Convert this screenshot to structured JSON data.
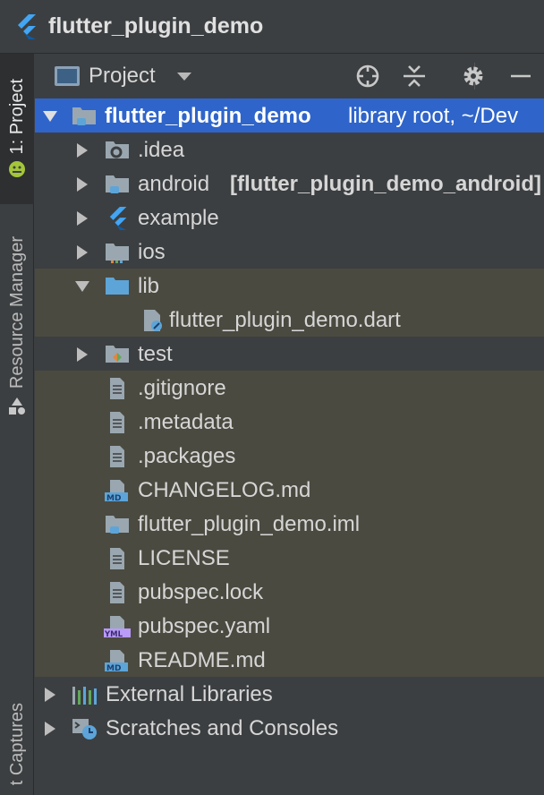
{
  "window": {
    "title": "flutter_plugin_demo"
  },
  "left_strip": {
    "tabs": [
      {
        "label": "1: Project"
      },
      {
        "label": "Resource Manager"
      },
      {
        "label": "t Captures"
      }
    ]
  },
  "toolbar": {
    "view_label": "Project",
    "icons": [
      "locate-icon",
      "collapse-all-icon",
      "gear-icon",
      "minimize-icon"
    ]
  },
  "tree": {
    "root": {
      "name": "flutter_plugin_demo",
      "extra": "library root,  ~/Dev"
    },
    "items": [
      {
        "name": ".idea"
      },
      {
        "name": "android",
        "module": "[flutter_plugin_demo_android]"
      },
      {
        "name": "example"
      },
      {
        "name": "ios"
      },
      {
        "name": "lib"
      },
      {
        "name": "flutter_plugin_demo.dart"
      },
      {
        "name": "test"
      },
      {
        "name": ".gitignore"
      },
      {
        "name": ".metadata"
      },
      {
        "name": ".packages"
      },
      {
        "name": "CHANGELOG.md"
      },
      {
        "name": "flutter_plugin_demo.iml"
      },
      {
        "name": "LICENSE"
      },
      {
        "name": "pubspec.lock"
      },
      {
        "name": "pubspec.yaml"
      },
      {
        "name": "README.md"
      }
    ],
    "external_libraries": "External Libraries",
    "scratches": "Scratches and Consoles"
  },
  "colors": {
    "selection": "#2f65ca",
    "folder": "#9aa7b0",
    "folder_blue": "#5da5d8",
    "flutter": "#42a5f5"
  }
}
